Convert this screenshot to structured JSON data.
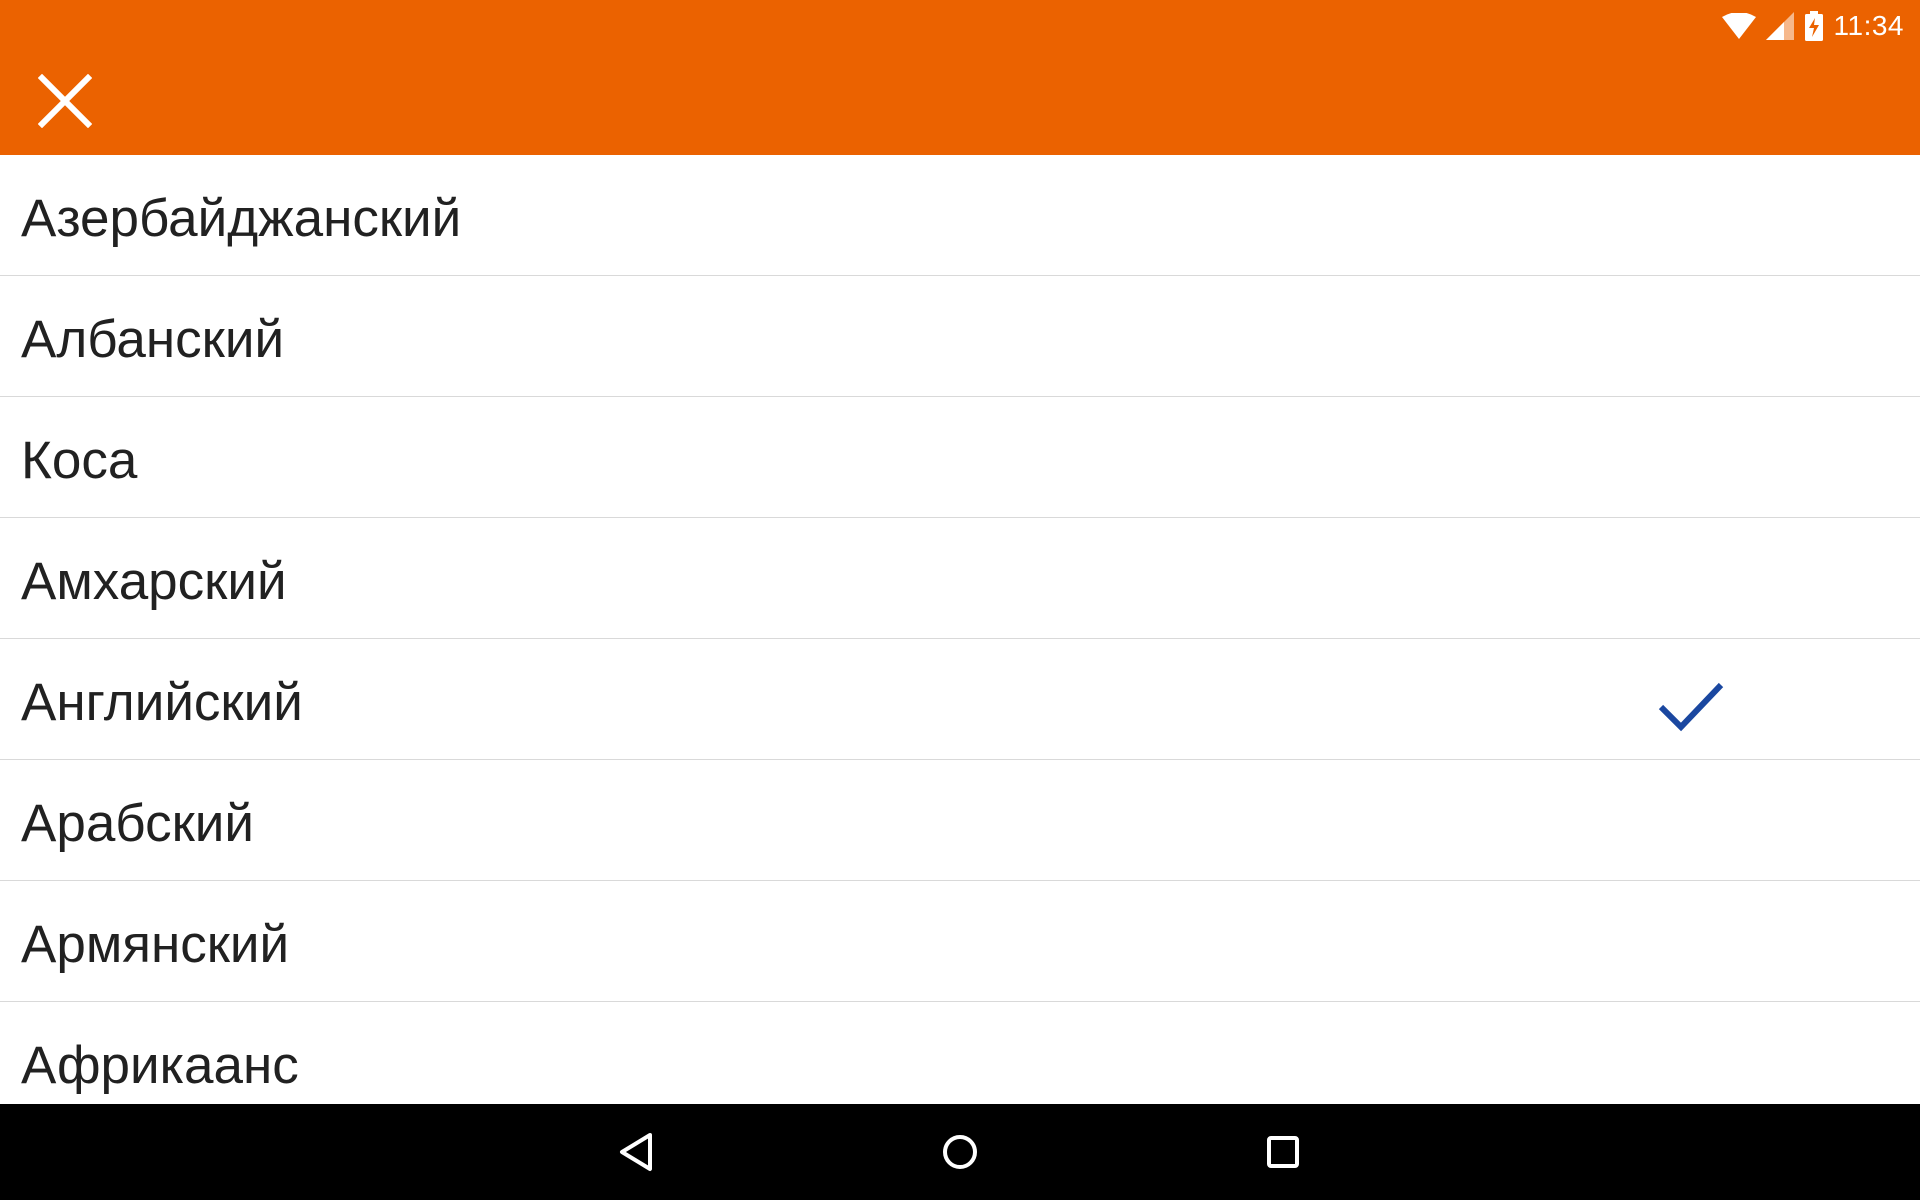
{
  "status_bar": {
    "time": "11:34",
    "icons": [
      "wifi-icon",
      "cell-signal-icon",
      "battery-charging-icon"
    ]
  },
  "app_bar": {
    "color": "#EB6200",
    "close_icon": "close-icon"
  },
  "languages": [
    {
      "label": "Азербайджанский",
      "selected": false
    },
    {
      "label": "Албанский",
      "selected": false
    },
    {
      "label": "Коса",
      "selected": false
    },
    {
      "label": "Амхарский",
      "selected": false
    },
    {
      "label": "Английский",
      "selected": true
    },
    {
      "label": "Арабский",
      "selected": false
    },
    {
      "label": "Армянский",
      "selected": false
    },
    {
      "label": "Африкаанс",
      "selected": false
    }
  ],
  "check_color": "#1A47A0",
  "nav_bar": {
    "buttons": [
      "back-icon",
      "home-icon",
      "recents-icon"
    ]
  }
}
